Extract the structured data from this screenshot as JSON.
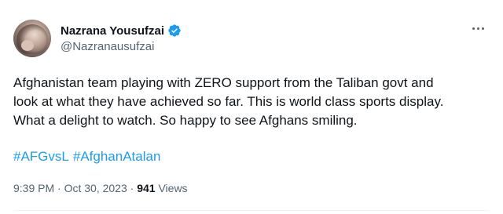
{
  "author": {
    "name": "Nazrana Yousufzai",
    "handle": "@Nazranausufzai",
    "verified": true,
    "verified_color": "#1d9bf0"
  },
  "more_icon": "more-horizontal-icon",
  "tweet": {
    "lines": [
      "Afghanistan team playing with ZERO support from the Taliban govt and",
      "look at what they have achieved so far. This is world class sports display.",
      "What a delight to watch. So happy to see Afghans smiling."
    ],
    "hashtags": [
      "#AFGvsL",
      "#AfghanAtalan"
    ]
  },
  "meta": {
    "time": "9:39 PM",
    "separator": " · ",
    "date": "Oct 30, 2023",
    "separator2": " · ",
    "views_count": "941",
    "views_label": " Views"
  },
  "colors": {
    "link": "#1d9bf0",
    "secondary_text": "#536471",
    "primary_text": "#0f1419"
  }
}
